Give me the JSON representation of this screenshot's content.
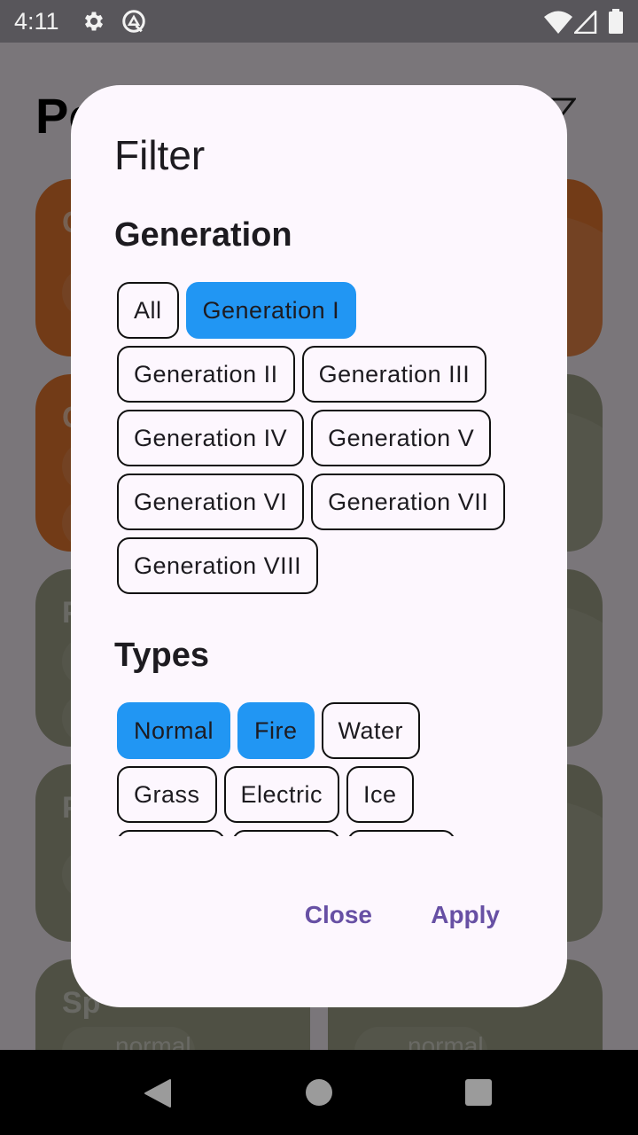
{
  "status_bar": {
    "time": "4:11",
    "icons_left": [
      "settings-gear-icon",
      "data-saver-icon"
    ],
    "icons_right": [
      "wifi-icon",
      "cell-signal-icon",
      "battery-icon"
    ]
  },
  "app": {
    "title_partial": "Po",
    "filter_icon": "filter-funnel-icon",
    "background_cards": [
      {
        "type_color": "#ee7c30",
        "name_partial": "C"
      },
      {
        "type_color": "#ee7c30",
        "name_partial": "C"
      },
      {
        "type_color": "#a6a88f",
        "name_partial": "P"
      },
      {
        "type_color": "#a6a88f",
        "name_partial": "P"
      },
      {
        "type_color": "#a6a88f",
        "name_partial": "Sp",
        "type_label": "normal"
      },
      {
        "type_color": "#a6a88f",
        "type_label": "normal"
      }
    ]
  },
  "dialog": {
    "title": "Filter",
    "generation": {
      "title": "Generation",
      "chips": [
        {
          "label": "All",
          "selected": false
        },
        {
          "label": "Generation I",
          "selected": true
        },
        {
          "label": "Generation II",
          "selected": false
        },
        {
          "label": "Generation III",
          "selected": false
        },
        {
          "label": "Generation IV",
          "selected": false
        },
        {
          "label": "Generation V",
          "selected": false
        },
        {
          "label": "Generation VI",
          "selected": false
        },
        {
          "label": "Generation VII",
          "selected": false
        },
        {
          "label": "Generation VIII",
          "selected": false
        }
      ]
    },
    "types": {
      "title": "Types",
      "chips": [
        {
          "label": "Normal",
          "selected": true
        },
        {
          "label": "Fire",
          "selected": true
        },
        {
          "label": "Water",
          "selected": false
        },
        {
          "label": "Grass",
          "selected": false
        },
        {
          "label": "Electric",
          "selected": false
        },
        {
          "label": "Ice",
          "selected": false
        }
      ]
    },
    "actions": {
      "close": "Close",
      "apply": "Apply"
    }
  },
  "colors": {
    "selected_chip": "#2196f3",
    "action_text": "#6750a4",
    "dialog_bg": "#fdf7fe"
  },
  "nav_bar": {
    "buttons": [
      "back-icon",
      "home-icon",
      "recents-icon"
    ]
  }
}
